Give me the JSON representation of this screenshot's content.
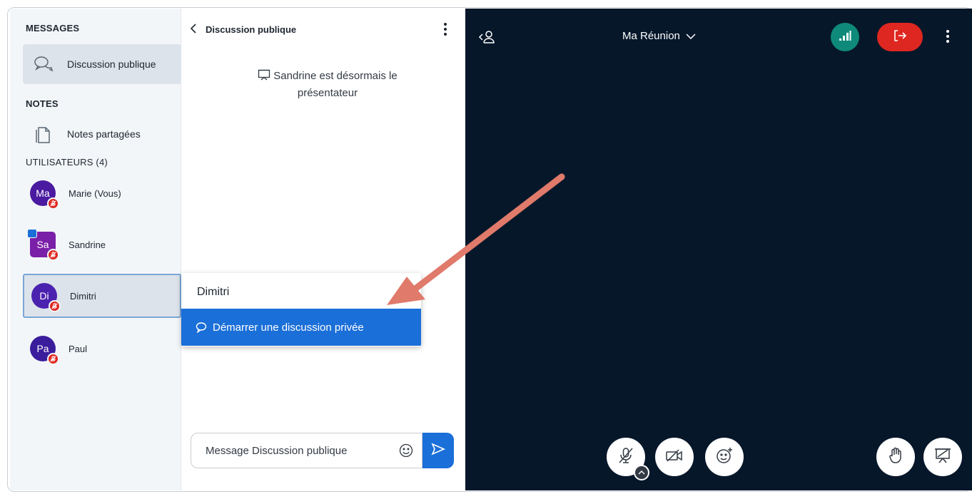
{
  "sidebar": {
    "messages_title": "MESSAGES",
    "public_chat_label": "Discussion publique",
    "notes_title": "NOTES",
    "shared_notes_label": "Notes partagées",
    "users_title": "UTILISATEURS (4)",
    "users": [
      {
        "initials": "Ma",
        "name": "Marie (Vous)",
        "color": "#4a1aa0"
      },
      {
        "initials": "Sa",
        "name": "Sandrine",
        "color": "#7a1fa8"
      },
      {
        "initials": "Di",
        "name": "Dimitri",
        "color": "#4b22b0"
      },
      {
        "initials": "Pa",
        "name": "Paul",
        "color": "#3a1d9c"
      }
    ]
  },
  "chat": {
    "title": "Discussion publique",
    "system_message": "Sandrine est désormais le présentateur",
    "input_placeholder": "Message Discussion publique"
  },
  "dropdown": {
    "title": "Dimitri",
    "action_label": "Démarrer une discussion privée"
  },
  "video": {
    "meeting_title": "Ma Réunion"
  },
  "colors": {
    "accent": "#1b6fd8",
    "danger": "#df2721",
    "connection": "#0f8a7a",
    "video_bg": "#06172a",
    "annotation_arrow": "#e07a6a"
  },
  "icons": [
    "chat-bubbles-icon",
    "notes-icon",
    "mic-off-icon",
    "presenter-icon",
    "chevron-left-icon",
    "kebab-icon",
    "send-icon",
    "emoji-icon",
    "user-list-icon",
    "chevron-down-icon",
    "signal-icon",
    "leave-icon",
    "camera-off-icon",
    "reaction-icon",
    "raise-hand-icon",
    "presentation-icon"
  ]
}
